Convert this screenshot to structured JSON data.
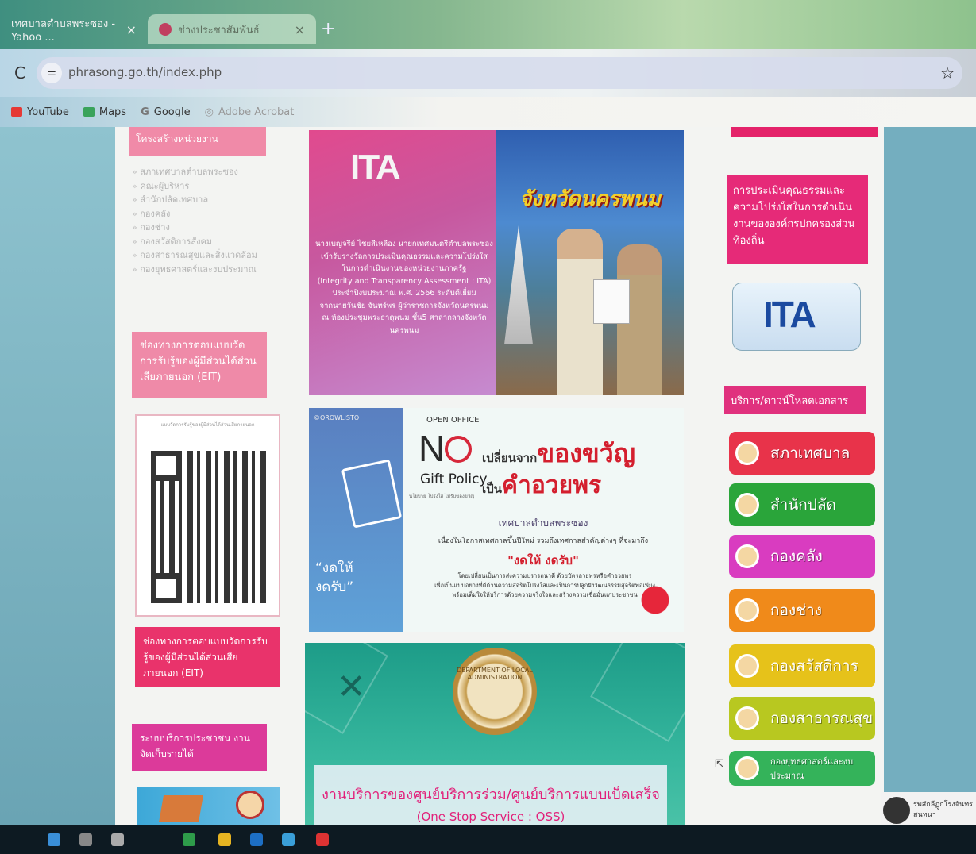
{
  "browser": {
    "tabs": [
      {
        "title": "เทศบาลตำบลพระซอง - Yahoo ...",
        "close": "×"
      },
      {
        "title": "ช่างประชาสัมพันธ์",
        "close": "×"
      }
    ],
    "new_tab": "+",
    "reload_icon": "reload-icon",
    "url": "phrasong.go.th/index.php",
    "bookmark_star": "☆",
    "bookmarks": [
      {
        "label": "YouTube",
        "color": "#e53935"
      },
      {
        "label": "Maps",
        "color": "#3aa35b"
      },
      {
        "label": "Google",
        "color": "#777777"
      },
      {
        "label": "Adobe Acrobat",
        "color": "#777777"
      }
    ]
  },
  "left": {
    "heading": "โครงสร้างหน่วยงาน",
    "menu": [
      "สภาเทศบาลตำบลพระซอง",
      "คณะผู้บริหาร",
      "สำนักปลัดเทศบาล",
      "กองคลัง",
      "กองช่าง",
      "กองสวัสดิการสังคม",
      "กองสาธารณสุขและสิ่งแวดล้อม",
      "กองยุทธศาสตร์และงบประมาณ"
    ],
    "eit_box": "ช่องทางการตอบแบบวัดการรับรู้ของผู้มีส่วนได้ส่วนเสียภายนอก (EIT)",
    "qr_caption": "แบบวัดการรับรู้ของผู้มีส่วนได้ส่วนเสียภายนอก",
    "eit_box2": "ช่องทางการตอบแบบวัดการรับรู้ของผู้มีส่วนได้ส่วนเสียภายนอก (EIT)",
    "service_box": "ระบบบริการประชาชน งานจัดเก็บรายได้"
  },
  "center": {
    "ita_banner": {
      "logo": "ITA",
      "province_title": "จังหวัดนครพนม",
      "lines": [
        "นางเบญจรีย์ ไชยสีเหลือง นายกเทศมนตรีตำบลพระซอง",
        "เข้ารับรางวัลการประเมินคุณธรรมและความโปร่งใส",
        "ในการดำเนินงานของหน่วยงานภาครัฐ",
        "(Integrity and Transparency Assessment : ITA)",
        "ประจำปีงบประมาณ พ.ศ. 2566 ระดับดีเยี่ยม",
        "จากนายวันชัย จันทร์พร ผู้ว่าราชการจังหวัดนครพนม",
        "ณ ห้องประชุมพระธาตุพนม ชั้น5 ศาลากลางจังหวัดนครพนม"
      ]
    },
    "no_gift": {
      "credit": "©OROWLISTO",
      "open_office": "OPEN OFFICE",
      "big_n": "N",
      "gift_policy": "Gift Policy",
      "gift_sub": "นโยบาย โปร่งใส ไม่รับของขวัญ",
      "change_from": "เปลี่ยนจาก",
      "change_from_red": "ของขวัญ",
      "change_to": "เป็น",
      "change_to_red": "คำอวยพร",
      "municipality": "เทศบาลตำบลพระซอง",
      "occasion": "เนื่องในโอกาสเทศกาลขึ้นปีใหม่ รวมถึงเทศกาลสำคัญต่างๆ ที่จะมาถึง",
      "slogan": "\"งดให้ งดรับ\"",
      "desc1": "โดยเปลี่ยนเป็นการส่งความปรารถนาดี ด้วยบัตรอวยพรหรือคำอวยพร",
      "desc2": "เพื่อเป็นแบบอย่างที่ดีด้านความสุจริตโปร่งใสและเป็นการปลูกฝังวัฒนธรรมสุจริตพอเพียง",
      "desc3": "พร้อมเต็มใจให้บริการด้วยความจริงใจและสร้างความเชื่อมั่นแก่ประชาชน",
      "left_quote1": "“งดให้",
      "left_quote2": "งดรับ”"
    },
    "oss": {
      "emblem_text": "DEPARTMENT OF LOCAL ADMINISTRATION",
      "title": "งานบริการของศูนย์บริการร่วม/ศูนย์บริการแบบเบ็ดเสร็จ",
      "subtitle": "(One Stop Service : OSS)"
    }
  },
  "right": {
    "ethics_box": "การประเมินคุณธรรมและความโปร่งใสในการดำเนินงานขององค์กรปกครองส่วนท้องถิ่น",
    "ita_logo": "ITA",
    "download_heading": "บริการ/ดาวน์โหลดเอกสาร",
    "buttons": [
      {
        "label": "สภาเทศบาล",
        "color": "#e8334a"
      },
      {
        "label": "สำนักปลัด",
        "color": "#2aa53a"
      },
      {
        "label": "กองคลัง",
        "color": "#d93cc0"
      },
      {
        "label": "กองช่าง",
        "color": "#f08a1a"
      },
      {
        "label": "กองสวัสดิการ",
        "color": "#e6c21a"
      },
      {
        "label": "กองสาธารณสุข",
        "color": "#b8c820"
      },
      {
        "label": "กองยุทธศาสตร์และงบประมาณ",
        "color": "#34b35a"
      }
    ]
  },
  "chat": {
    "line1": "รพสักลีฏูกโรงจันทร",
    "line2": "สนทนา"
  }
}
